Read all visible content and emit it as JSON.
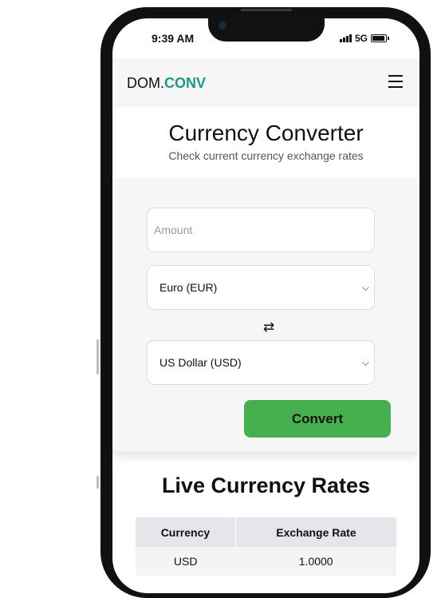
{
  "status_bar": {
    "time": "9:39 AM",
    "network": "5G"
  },
  "header": {
    "logo_main": "DOM.",
    "logo_accent": "CONV"
  },
  "page": {
    "title": "Currency Converter",
    "subtitle": "Check current currency exchange rates"
  },
  "form": {
    "amount_placeholder": "Amount",
    "from_currency": "Euro (EUR)",
    "to_currency": "US Dollar (USD)",
    "convert_label": "Convert"
  },
  "rates": {
    "title": "Live Currency Rates",
    "columns": [
      "Currency",
      "Exchange Rate"
    ],
    "rows": [
      {
        "currency": "USD",
        "rate": "1.0000"
      }
    ]
  },
  "colors": {
    "accent": "#1a9a8a",
    "convert_button": "#46b04e"
  }
}
